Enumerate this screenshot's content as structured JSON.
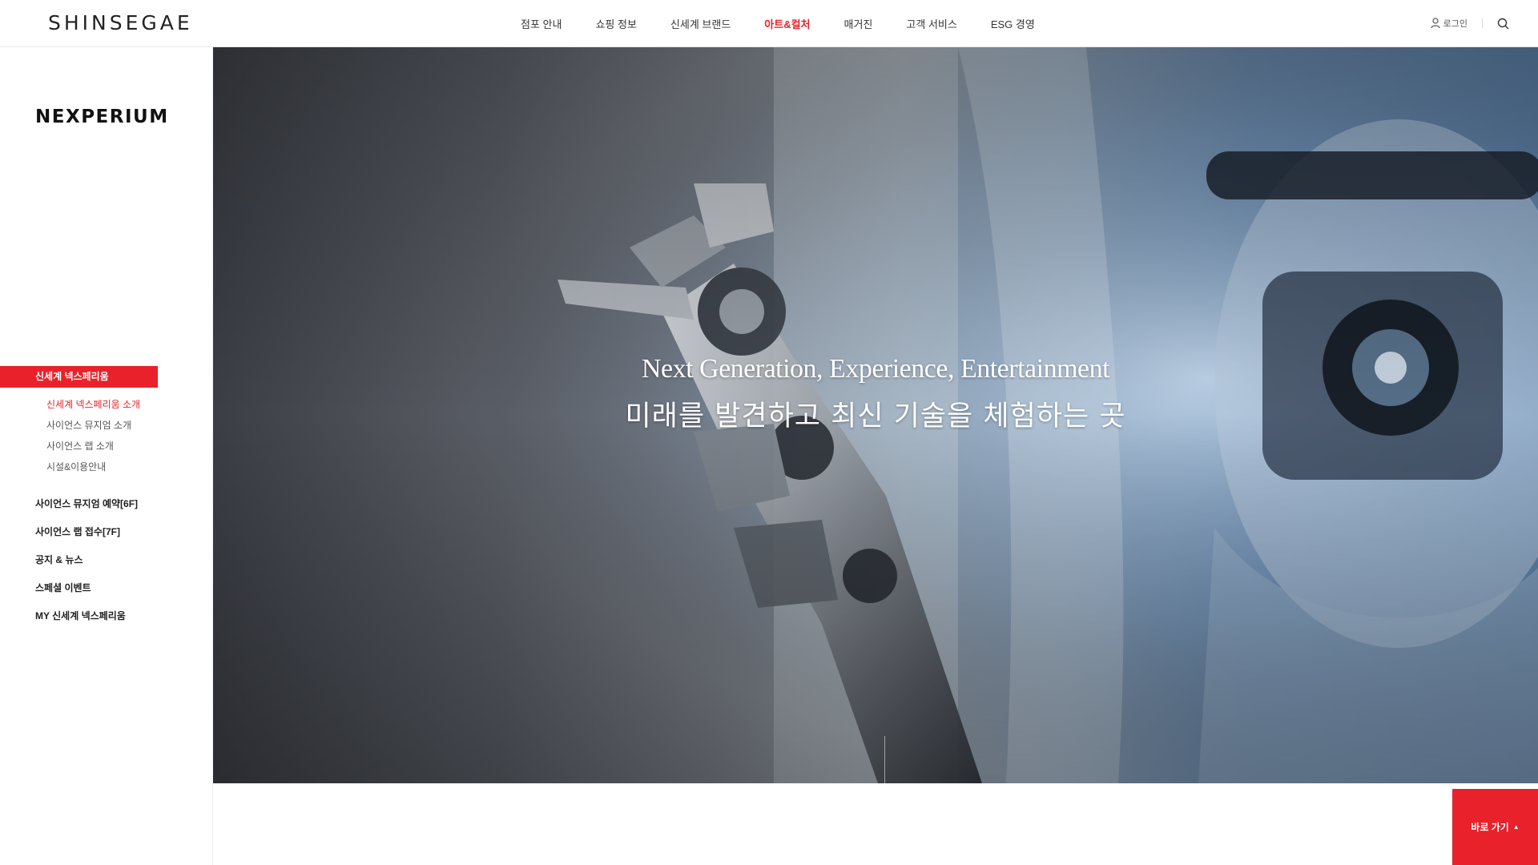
{
  "header": {
    "logo": "SHINSEGAE",
    "nav": [
      "점포 안내",
      "쇼핑 정보",
      "신세계 브랜드",
      "아트&컬처",
      "매거진",
      "고객 서비스",
      "ESG 경영"
    ],
    "active_nav": "아트&컬처",
    "login_label": "로그인",
    "login_icon": "user-icon",
    "search_icon": "search-icon"
  },
  "sidebar": {
    "brand": "NEXPERIUM",
    "active_section": "신세계 넥스페리움",
    "sub_items": [
      "신세계 넥스페리움 소개",
      "사이언스 뮤지엄 소개",
      "사이언스 랩 소개",
      "시설&이용안내"
    ],
    "current_sub": "신세계 넥스페리움 소개",
    "items": [
      "사이언스 뮤지엄 예약[6F]",
      "사이언스 랩 접수[7F]",
      "공지 & 뉴스",
      "스페셜 이벤트",
      "MY 신세계 넥스페리움"
    ]
  },
  "hero": {
    "title": "Next Generation, Experience, Entertainment",
    "subtitle": "미래를 발견하고 최신 기술을 체험하는 곳"
  },
  "quick": {
    "label": "바로 가기",
    "icon": "caret-up-icon"
  },
  "colors": {
    "accent": "#e8212b",
    "text": "#222222"
  }
}
